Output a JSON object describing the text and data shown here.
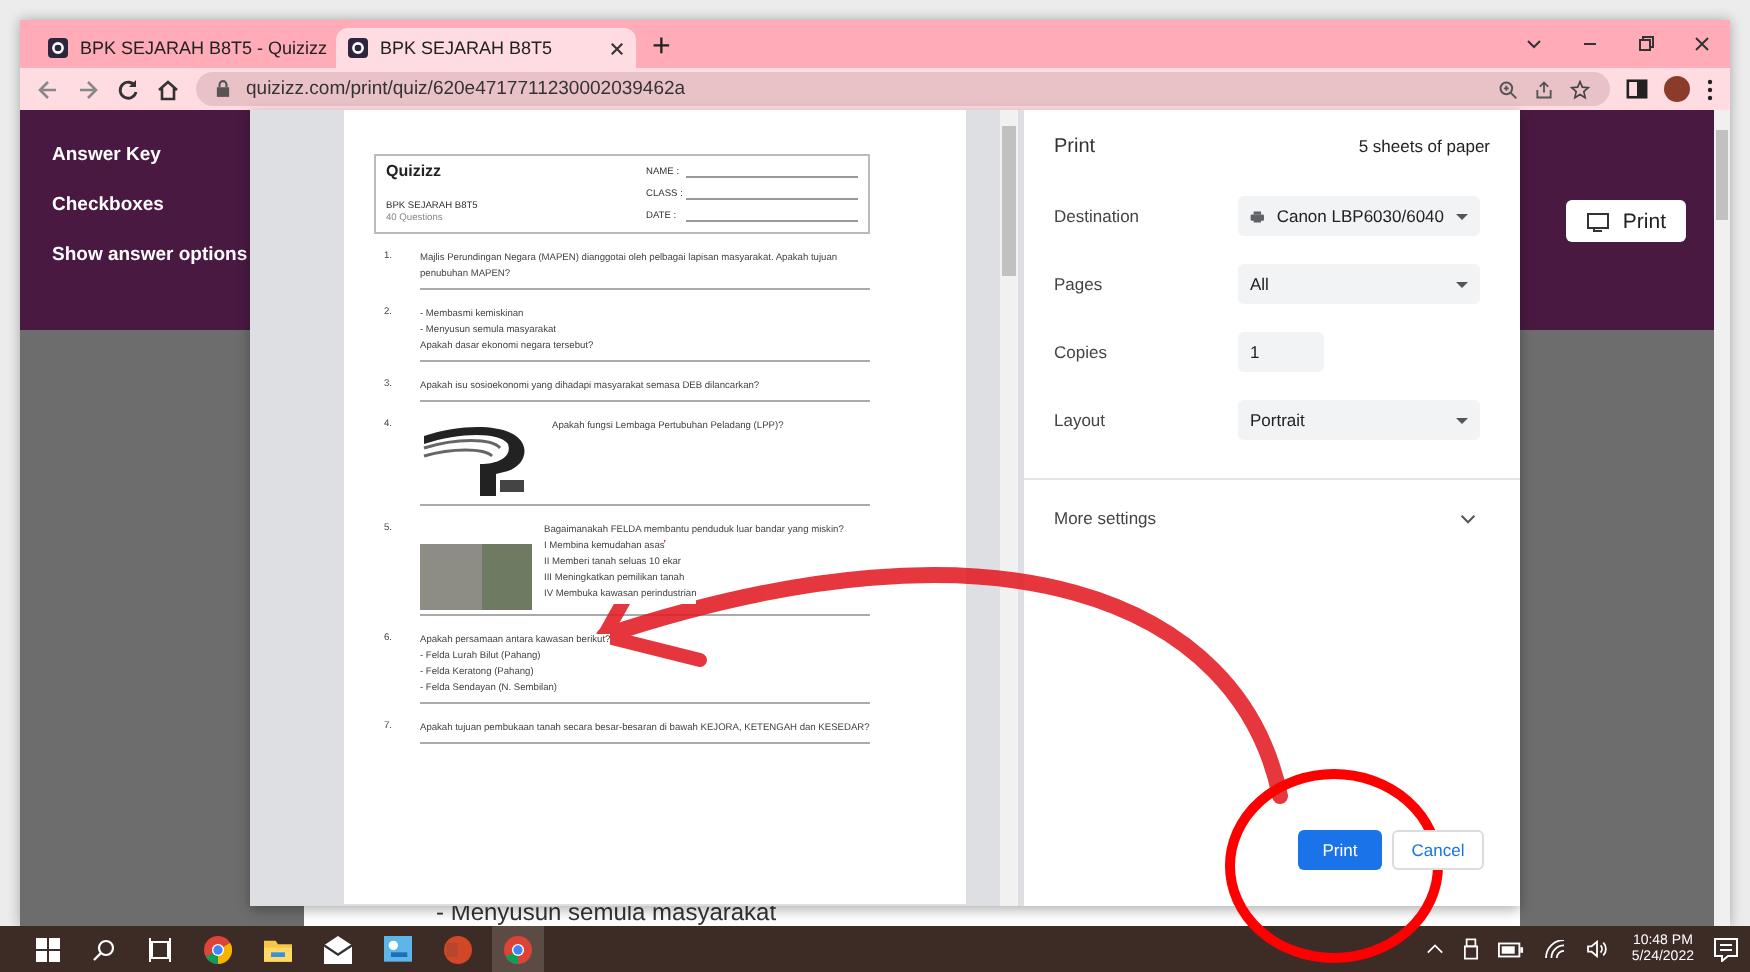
{
  "browser": {
    "tabs": [
      {
        "title": "BPK SEJARAH B8T5 - Quizizz",
        "selected": false
      },
      {
        "title": "BPK SEJARAH B8T5",
        "selected": true
      }
    ],
    "new_tab": "+",
    "url": "quizizz.com/print/quiz/620e4717711230002039462a"
  },
  "sidebar": {
    "items": [
      "Answer Key",
      "Checkboxes",
      "Show answer options"
    ]
  },
  "header_button": "Print",
  "background_text": "- Menyusun semula masyarakat",
  "preview": {
    "logo": "Quizizz",
    "fields": [
      "NAME :",
      "CLASS :",
      "DATE :"
    ],
    "quiz_title": "BPK SEJARAH B8T5",
    "question_count": "40 Questions",
    "questions": [
      {
        "number": "1.",
        "lines": [
          "Majlis Perundingan Negara (MAPEN) dianggotai oleh pelbagai lapisan masyarakat. Apakah tujuan penubuhan MAPEN?"
        ]
      },
      {
        "number": "2.",
        "lines": [
          "- Membasmi kemiskinan",
          "- Menyusun semula masyarakat",
          "Apakah dasar ekonomi negara tersebut?"
        ]
      },
      {
        "number": "3.",
        "lines": [
          "Apakah isu sosioekonomi yang dihadapi masyarakat semasa DEB dilancarkan?"
        ]
      },
      {
        "number": "4.",
        "kind": "logo",
        "lines": [
          "Apakah fungsi Lembaga Pertubuhan Peladang (LPP)?"
        ]
      },
      {
        "number": "5.",
        "kind": "photo",
        "lines": [
          "Bagaimanakah FELDA membantu penduduk luar bandar yang miskin?",
          "I Membina kemudahan asas",
          "II Memberi tanah seluas 10 ekar",
          "III Meningkatkan pemilikan tanah",
          "IV Membuka kawasan perindustrian"
        ]
      },
      {
        "number": "6.",
        "lines": [
          "Apakah persamaan antara kawasan berikut?",
          "- Felda Lurah Bilut (Pahang)",
          "- Felda Keratong (Pahang)",
          "- Felda Sendayan (N. Sembilan)"
        ]
      },
      {
        "number": "7.",
        "lines": [
          "Apakah tujuan pembukaan tanah secara besar-besaran di bawah KEJORA, KETENGAH dan KESEDAR?"
        ]
      }
    ]
  },
  "print_dialog": {
    "title": "Print",
    "sheets": "5 sheets of paper",
    "settings": [
      {
        "label": "Destination",
        "kind": "destination",
        "value": "Canon LBP6030/6040"
      },
      {
        "label": "Pages",
        "kind": "select",
        "value": "All"
      },
      {
        "label": "Copies",
        "kind": "input",
        "value": "1"
      },
      {
        "label": "Layout",
        "kind": "select",
        "value": "Portrait"
      }
    ],
    "more_settings": "More settings",
    "buttons": [
      {
        "label": "Print",
        "kind": "primary"
      },
      {
        "label": "Cancel",
        "kind": "secondary"
      }
    ]
  },
  "taskbar": {
    "time": "10:48 PM",
    "date": "5/24/2022"
  }
}
